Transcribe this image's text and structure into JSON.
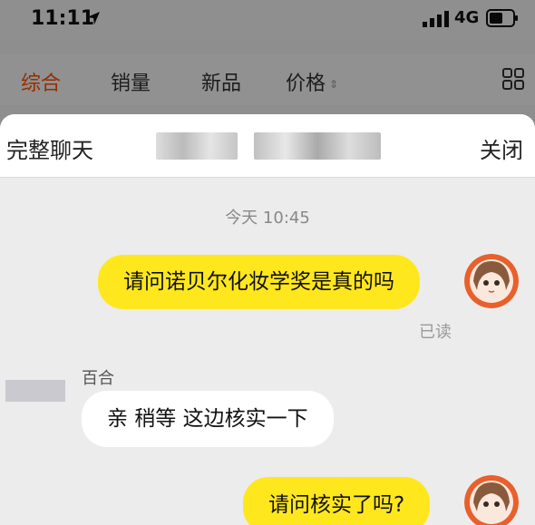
{
  "status": {
    "time": "11:11",
    "network": "4G"
  },
  "tabs": [
    {
      "label": "综合",
      "active": true
    },
    {
      "label": "销量",
      "active": false
    },
    {
      "label": "新品",
      "active": false
    },
    {
      "label": "价格",
      "active": false
    }
  ],
  "sheet": {
    "title": "完整聊天",
    "close_label": "关闭"
  },
  "messages": {
    "timestamp": "今天 10:45",
    "m1": {
      "text": "请问诺贝尔化妆学奖是真的吗",
      "read_label": "已读"
    },
    "m2": {
      "sender": "百合",
      "text": "亲  稍等  这边核实一下"
    },
    "m3": {
      "text": "请问核实了吗?"
    }
  },
  "colors": {
    "accent": "#ff5000",
    "outgoing_bubble": "#ffe71e",
    "incoming_bubble": "#ffffff"
  }
}
